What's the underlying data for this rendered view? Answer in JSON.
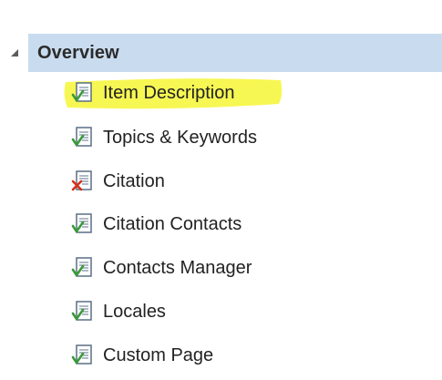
{
  "tree": {
    "group": {
      "label": "Overview",
      "expanded": true,
      "expander_icon": "triangle-expanded-icon",
      "selected_color": "#c9dcef"
    },
    "items": [
      {
        "label": "Item Description",
        "icon": "page-check-icon",
        "status": "valid",
        "highlighted": true
      },
      {
        "label": "Topics & Keywords",
        "icon": "page-check-icon",
        "status": "valid",
        "highlighted": false
      },
      {
        "label": "Citation",
        "icon": "page-error-icon",
        "status": "error",
        "highlighted": false
      },
      {
        "label": "Citation Contacts",
        "icon": "page-check-icon",
        "status": "valid",
        "highlighted": false
      },
      {
        "label": "Contacts Manager",
        "icon": "page-check-icon",
        "status": "valid",
        "highlighted": false
      },
      {
        "label": "Locales",
        "icon": "page-check-icon",
        "status": "valid",
        "highlighted": false
      },
      {
        "label": "Custom Page",
        "icon": "page-check-icon",
        "status": "valid",
        "highlighted": false
      }
    ],
    "highlight_color": "#f5f542",
    "valid_color": "#3a9a3a",
    "error_color": "#d4301c"
  }
}
